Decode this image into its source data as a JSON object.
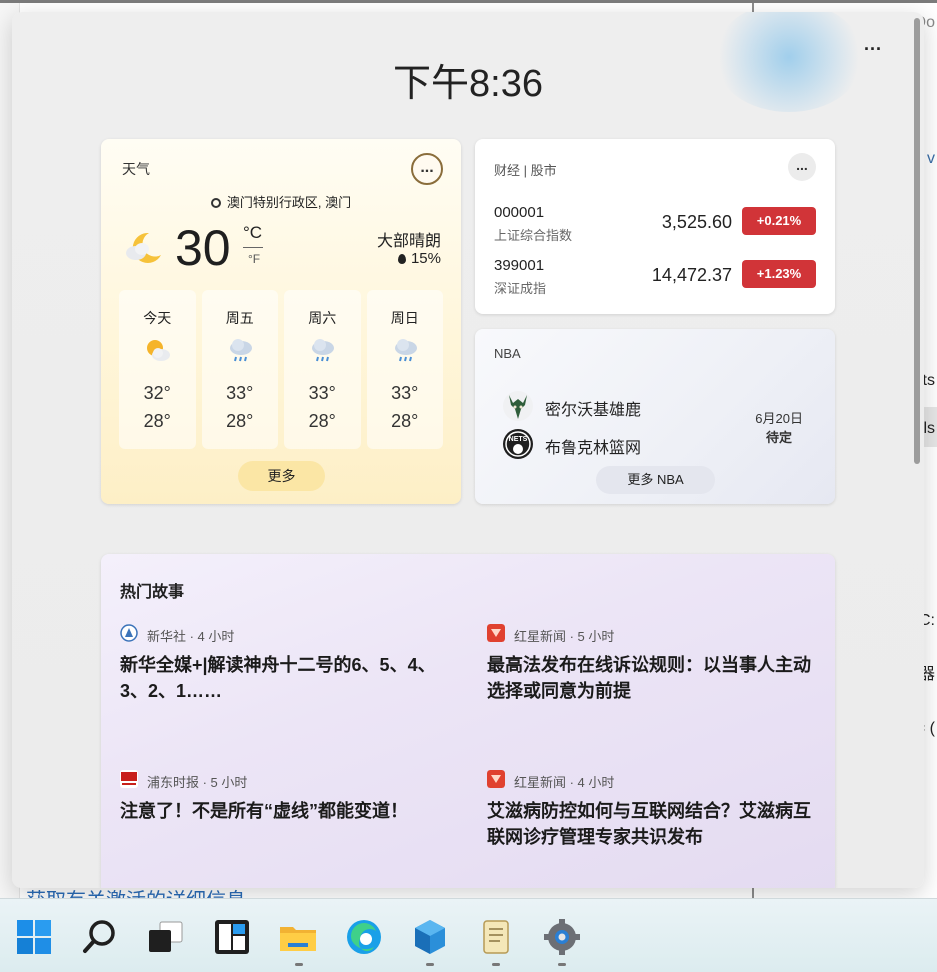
{
  "background": {
    "frag_lines": [
      "Do",
      "v",
      "ts",
      "ls",
      "C:",
      "器",
      "= ("
    ],
    "link_text": "获取有关激活的详细信息"
  },
  "panel": {
    "more_label": "...",
    "clock": "下午8:36"
  },
  "weather": {
    "title": "天气",
    "menu": "...",
    "location": "澳门特别行政区, 澳门",
    "current_icon": "moon-partly-cloudy-icon",
    "temperature": "30",
    "unit_c": "°C",
    "unit_f": "°F",
    "condition": "大部晴朗",
    "precip": "15%",
    "days": [
      {
        "name": "今天",
        "icon": "sun-cloud-icon",
        "high": "32°",
        "low": "28°"
      },
      {
        "name": "周五",
        "icon": "rain-cloud-icon",
        "high": "33°",
        "low": "28°"
      },
      {
        "name": "周六",
        "icon": "rain-cloud-icon",
        "high": "33°",
        "low": "28°"
      },
      {
        "name": "周日",
        "icon": "rain-cloud-icon",
        "high": "33°",
        "low": "28°"
      }
    ],
    "more": "更多"
  },
  "finance": {
    "title": "财经 | 股市",
    "menu": "...",
    "rows": [
      {
        "code": "000001",
        "name": "上证综合指数",
        "value": "3,525.60",
        "change": "+0.21%"
      },
      {
        "code": "399001",
        "name": "深证成指",
        "value": "14,472.37",
        "change": "+1.23%"
      }
    ],
    "accent": "#d13438"
  },
  "nba": {
    "title": "NBA",
    "teams": [
      {
        "name": "密尔沃基雄鹿",
        "icon": "bucks-logo-icon"
      },
      {
        "name": "布鲁克林篮网",
        "icon": "nets-logo-icon"
      }
    ],
    "date": "6月20日",
    "status": "待定",
    "more": "更多 NBA"
  },
  "stories": {
    "title": "热门故事",
    "items": [
      {
        "source": "新华社 · 4 小时",
        "icon": "xinhua-logo-icon",
        "headline": "新华全媒+|解读神舟十二号的6、5、4、3、2、1……"
      },
      {
        "source": "红星新闻 · 5 小时",
        "icon": "hongxing-logo-icon",
        "headline": "最高法发布在线诉讼规则：以当事人主动选择或同意为前提"
      },
      {
        "source": "浦东时报 · 5 小时",
        "icon": "pudong-logo-icon",
        "headline": "注意了！不是所有“虚线”都能变道！"
      },
      {
        "source": "红星新闻 · 4 小时",
        "icon": "hongxing-logo-icon",
        "headline": "艾滋病防控如何与互联网结合？艾滋病互联网诊疗管理专家共识发布"
      }
    ]
  },
  "taskbar": {
    "items": [
      "start-icon",
      "search-icon",
      "task-view-icon",
      "widgets-icon",
      "file-explorer-icon",
      "edge-icon",
      "app-cube-icon",
      "notepad-scroll-icon",
      "settings-gear-icon"
    ]
  }
}
